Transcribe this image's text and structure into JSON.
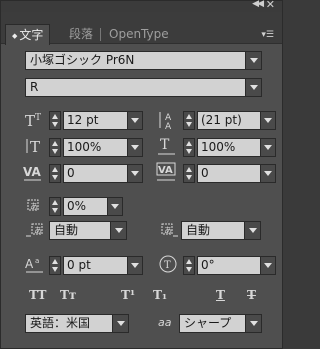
{
  "tabs": [
    {
      "label": "文字",
      "active": true
    },
    {
      "label": "段落",
      "active": false
    },
    {
      "label": "OpenType",
      "active": false
    }
  ],
  "font": {
    "family": "小塚ゴシック Pr6N",
    "style": "R"
  },
  "size": "12 pt",
  "leading": "(21 pt)",
  "vertical_scale": "100%",
  "horizontal_scale": "100%",
  "kerning": "0",
  "tracking": "0",
  "tsume": "0%",
  "aki_left": "自動",
  "aki_right": "自動",
  "baseline_shift": "0 pt",
  "rotation": "0°",
  "style_buttons": {
    "all_caps": "TT",
    "small_caps": "Tт",
    "superscript": "T¹",
    "subscript": "T₁",
    "underline": "T",
    "strikethrough": "T"
  },
  "language": "英語：米国",
  "antialias_label": "aa",
  "antialias": "シャープ",
  "colors": {
    "panel": "#4f4f4f",
    "field": "#d2d2d2"
  }
}
